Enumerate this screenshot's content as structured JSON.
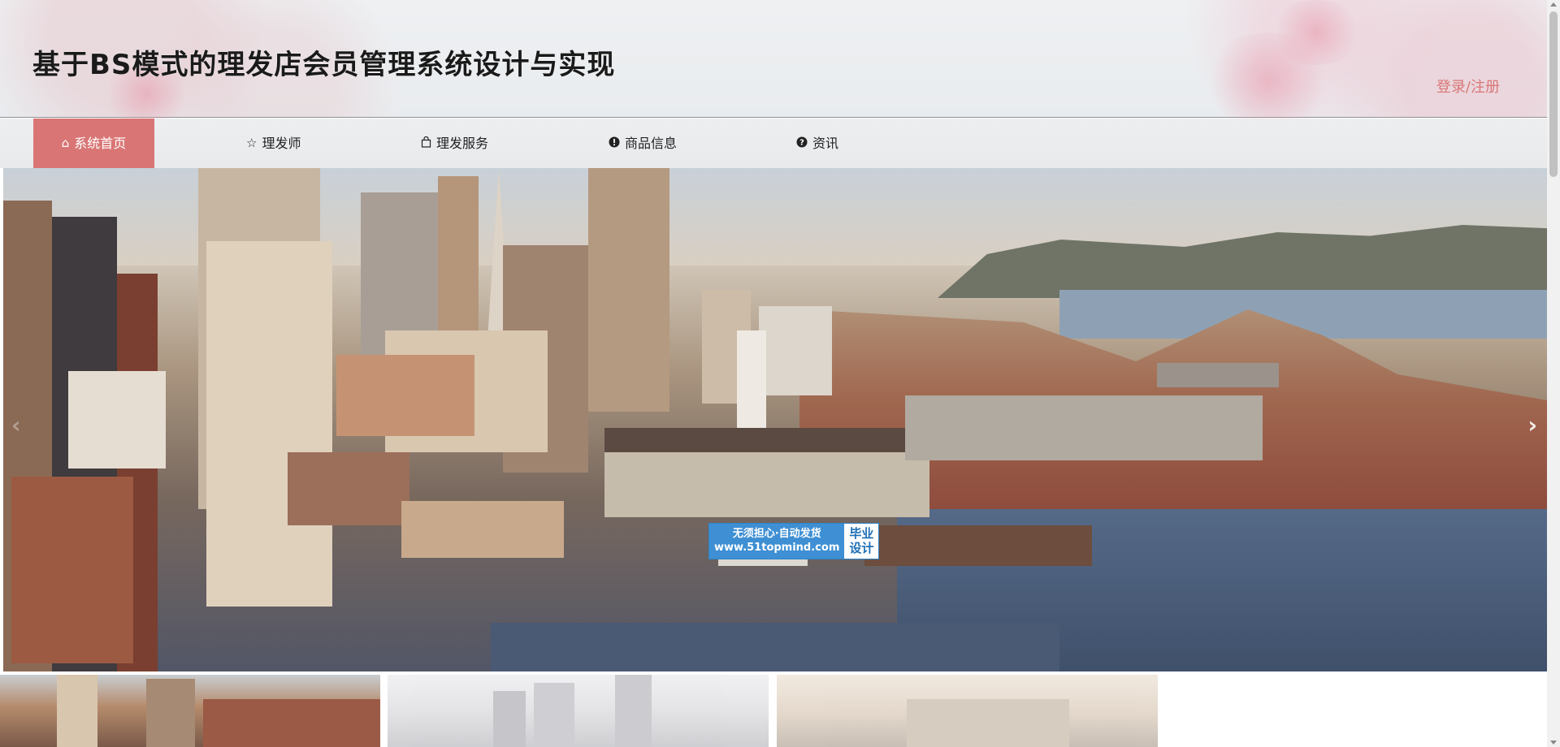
{
  "header": {
    "title": "基于BS模式的理发店会员管理系统设计与实现",
    "login_register": "登录/注册",
    "colors": {
      "login": "#d97777",
      "accent": "#d97675"
    }
  },
  "nav": {
    "items": [
      {
        "label": "系统首页",
        "icon": "home-icon",
        "active": true
      },
      {
        "label": "理发师",
        "icon": "star-icon"
      },
      {
        "label": "理发服务",
        "icon": "shopping-bag-icon"
      },
      {
        "label": "商品信息",
        "icon": "exclamation-circle-icon"
      },
      {
        "label": "资讯",
        "icon": "question-circle-icon"
      }
    ]
  },
  "carousel": {
    "prev_icon": "chevron-left-icon",
    "next_icon": "chevron-right-icon",
    "badge": {
      "left_line1": "无须担心·自动发货",
      "left_line2": "www.51topmind.com",
      "right_line1": "毕业",
      "right_line2": "设计"
    },
    "thumbnails": [
      "city-aerial-thumbnail",
      "skyline-thumbnail",
      "sunset-city-thumbnail"
    ]
  }
}
